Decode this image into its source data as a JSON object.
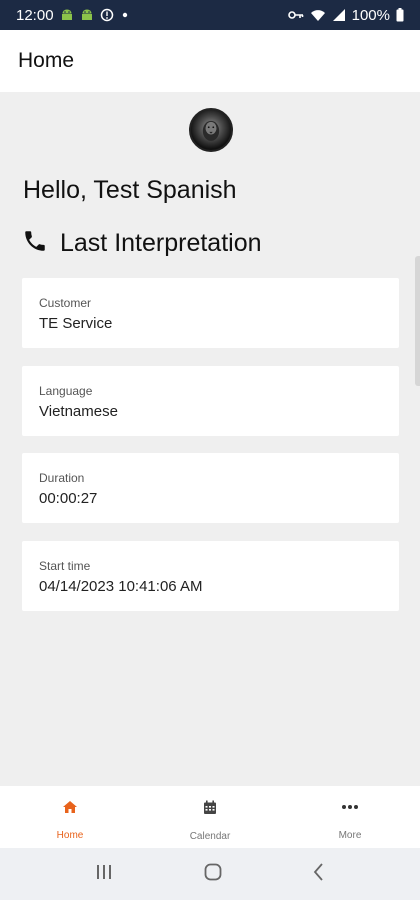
{
  "status_bar": {
    "time": "12:00",
    "battery": "100%",
    "icons_left": [
      "android-icon",
      "android-icon",
      "info-icon",
      "dot-icon"
    ],
    "icons_right": [
      "key-icon",
      "wifi-icon",
      "signal-icon",
      "battery-icon"
    ]
  },
  "app_bar": {
    "title": "Home"
  },
  "main": {
    "greeting": "Hello, Test Spanish",
    "section_title": "Last Interpretation",
    "section_icon": "phone-icon",
    "cards": [
      {
        "label": "Customer",
        "value": "TE Service"
      },
      {
        "label": "Language",
        "value": "Vietnamese"
      },
      {
        "label": "Duration",
        "value": "00:00:27"
      },
      {
        "label": "Start time",
        "value": "04/14/2023 10:41:06 AM"
      }
    ]
  },
  "bottom_nav": {
    "items": [
      {
        "label": "Home",
        "icon": "home-icon",
        "active": true
      },
      {
        "label": "Calendar",
        "icon": "calendar-icon",
        "active": false
      },
      {
        "label": "More",
        "icon": "more-icon",
        "active": false
      }
    ]
  },
  "colors": {
    "status_bar_bg": "#1c2a44",
    "accent": "#e8631c",
    "android_green": "#8bc34a",
    "background": "#efefef"
  }
}
